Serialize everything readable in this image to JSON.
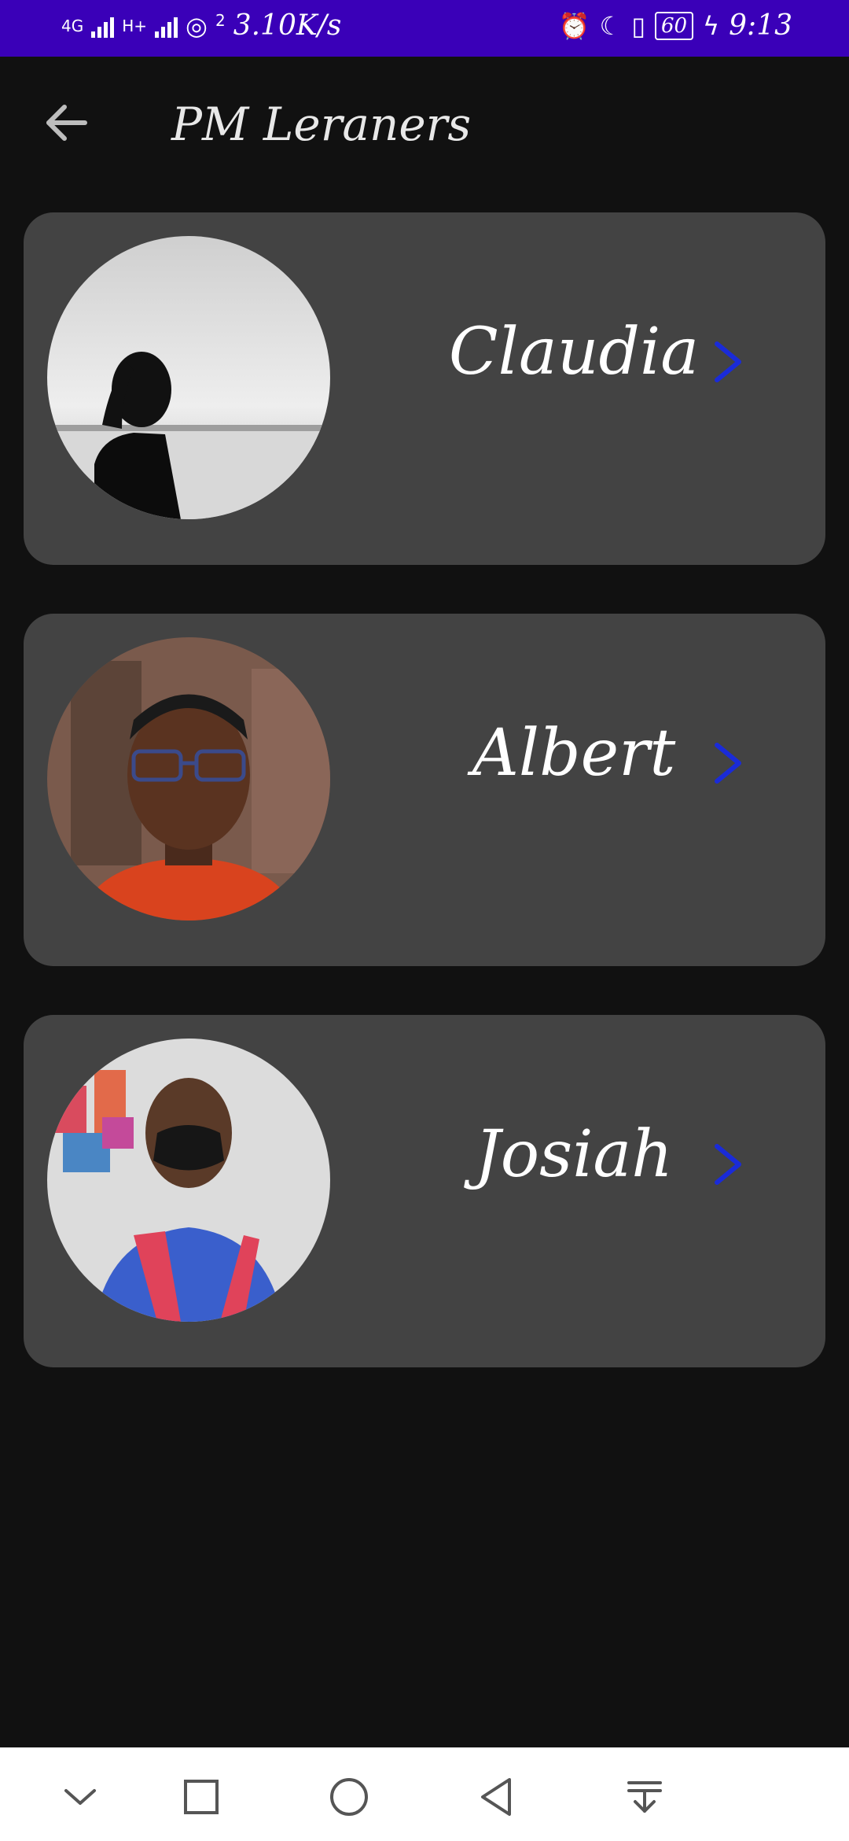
{
  "status_bar": {
    "network_1": "4G",
    "network_2": "H+",
    "hotspot_count": "2",
    "speed": "3.10K/s",
    "battery": "60",
    "time": "9:13",
    "icons": [
      "alarm-icon",
      "moon-icon",
      "vibrate-icon",
      "battery-icon",
      "charging-icon"
    ]
  },
  "app_bar": {
    "title": "PM Leraners",
    "back_icon": "arrow-left-icon"
  },
  "learners": [
    {
      "name": "Claudia",
      "chevron": ">"
    },
    {
      "name": "Albert",
      "chevron": ">"
    },
    {
      "name": "Josiah",
      "chevron": ">"
    }
  ],
  "nav_bar": {
    "icons": [
      "chevron-down-icon",
      "square-icon",
      "circle-home-icon",
      "triangle-back-icon",
      "notification-pull-icon"
    ]
  },
  "colors": {
    "status_bar": "#3a00b8",
    "background": "#111111",
    "card": "#434343",
    "accent_chevron": "#1a2bd8"
  }
}
